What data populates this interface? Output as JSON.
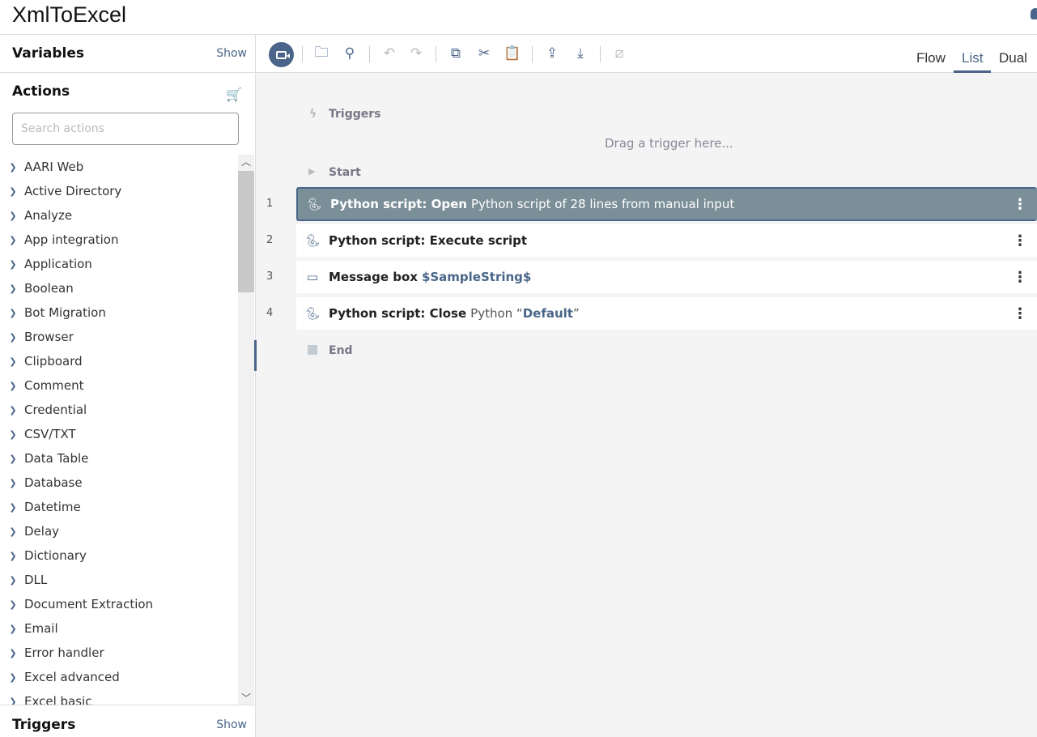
{
  "title": "XmlToExcel",
  "sidebar": {
    "variables": {
      "label": "Variables",
      "show": "Show"
    },
    "actions": {
      "label": "Actions",
      "search_placeholder": "Search actions",
      "items": [
        "AARI Web",
        "Active Directory",
        "Analyze",
        "App integration",
        "Application",
        "Boolean",
        "Bot Migration",
        "Browser",
        "Clipboard",
        "Comment",
        "Credential",
        "CSV/TXT",
        "Data Table",
        "Database",
        "Datetime",
        "Delay",
        "Dictionary",
        "DLL",
        "Document Extraction",
        "Email",
        "Error handler",
        "Excel advanced",
        "Excel basic"
      ]
    },
    "triggers": {
      "label": "Triggers",
      "show": "Show"
    }
  },
  "toolbar": {
    "views": [
      "Flow",
      "List",
      "Dual"
    ],
    "active_view": "List"
  },
  "flow": {
    "triggers_label": "Triggers",
    "drag_hint": "Drag a trigger here...",
    "start_label": "Start",
    "end_label": "End",
    "steps": [
      {
        "num": "1",
        "icon": "python-icon",
        "title": "Python script: Open",
        "detail": "Python script of 28 lines from manual input"
      },
      {
        "num": "2",
        "icon": "python-icon",
        "title": "Python script: Execute script"
      },
      {
        "num": "3",
        "icon": "message-box-icon",
        "title": "Message box",
        "var": "$SampleString$"
      },
      {
        "num": "4",
        "icon": "python-icon",
        "title": "Python script: Close",
        "detail_pre": "Python “",
        "var": "Default",
        "detail_post": "”"
      }
    ]
  },
  "colors": {
    "accent": "#4a6589",
    "selected_row": "#7b8f99",
    "canvas": "#f4f4f4"
  }
}
